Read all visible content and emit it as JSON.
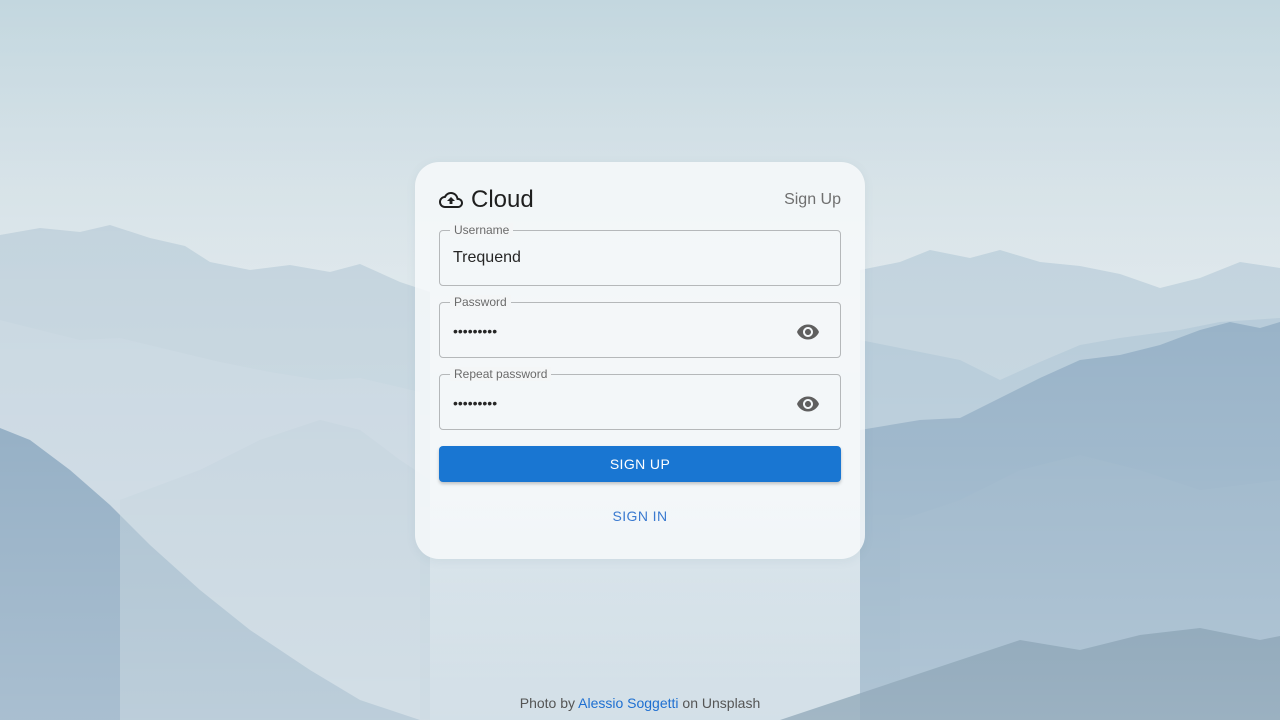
{
  "app": {
    "title": "Cloud",
    "header_action": "Sign Up"
  },
  "form": {
    "username": {
      "label": "Username",
      "value": "Trequend"
    },
    "password": {
      "label": "Password",
      "value": "•••••••••"
    },
    "repeat_password": {
      "label": "Repeat password",
      "value": "•••••••••"
    },
    "submit_label": "SIGN UP",
    "alt_label": "SIGN IN"
  },
  "credit": {
    "prefix": "Photo by",
    "author": "Alessio Soggetti",
    "suffix": "on Unsplash"
  },
  "icons": {
    "brand": "cloud-icon",
    "toggle_visibility": "eye-icon"
  },
  "colors": {
    "primary": "#1976d2",
    "link": "#1e6fd1"
  }
}
